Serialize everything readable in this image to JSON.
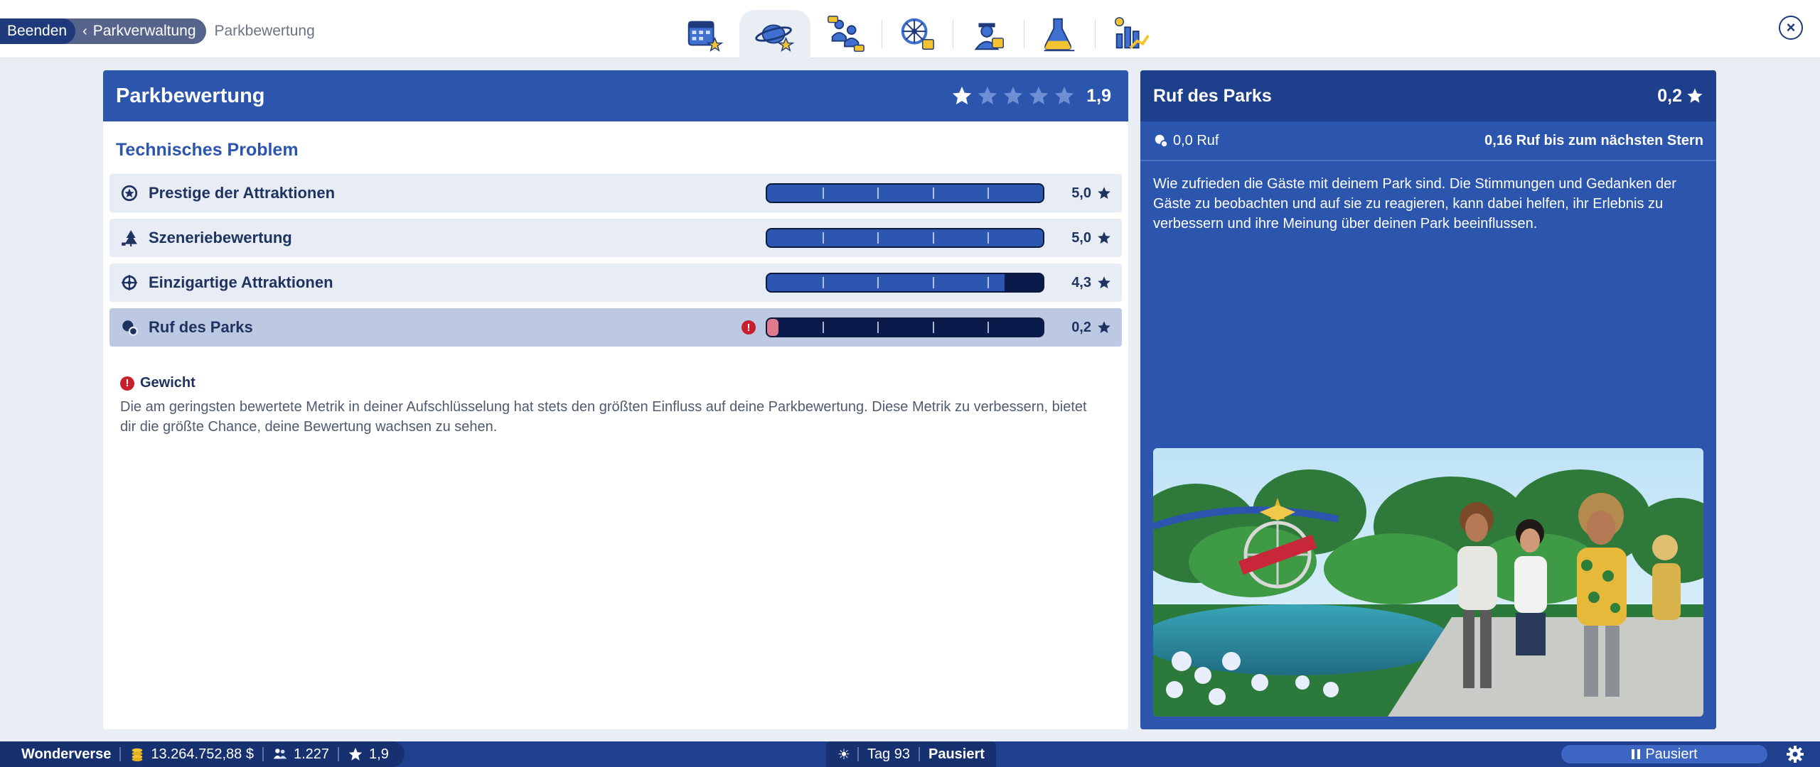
{
  "breadcrumb": {
    "exit_label": "Beenden",
    "parent_label": "Parkverwaltung",
    "current_label": "Parkbewertung"
  },
  "tabs": [
    {
      "name": "calendar",
      "icon": "calendar-star-icon",
      "active": false
    },
    {
      "name": "park-rating",
      "icon": "planet-star-icon",
      "active": true
    },
    {
      "name": "guests",
      "icon": "guests-icon",
      "active": false
    },
    {
      "name": "attractions",
      "icon": "ferris-wheel-icon",
      "active": false
    },
    {
      "name": "staff",
      "icon": "staff-icon",
      "active": false
    },
    {
      "name": "research",
      "icon": "research-flask-icon",
      "active": false
    },
    {
      "name": "finances",
      "icon": "finance-chart-icon",
      "active": false
    }
  ],
  "rating_panel": {
    "title": "Parkbewertung",
    "score": "1,9",
    "stars_value": 1.9,
    "section_title": "Technisches Problem",
    "metrics": [
      {
        "label": "Prestige der Attraktionen",
        "value": "5,0",
        "fraction": 1.0,
        "icon": "prestige-icon",
        "warning": false
      },
      {
        "label": "Szeneriebewertung",
        "value": "5,0",
        "fraction": 1.0,
        "icon": "scenery-tree-icon",
        "warning": false
      },
      {
        "label": "Einzigartige Attraktionen",
        "value": "4,3",
        "fraction": 0.86,
        "icon": "unique-attraction-icon",
        "warning": false
      },
      {
        "label": "Ruf des Parks",
        "value": "0,2",
        "fraction": 0.04,
        "icon": "reputation-icon",
        "warning": true
      }
    ],
    "weight": {
      "title": "Gewicht",
      "text": "Die am geringsten bewertete Metrik in deiner Aufschlüsselung hat stets den größten Einfluss auf deine Parkbewertung. Diese Metrik zu verbessern, bietet dir die größte Chance, deine Bewertung wachsen zu sehen."
    }
  },
  "detail_panel": {
    "title": "Ruf des Parks",
    "score": "0,2",
    "reputation": "0,0 Ruf",
    "next_star": "0,16 Ruf bis zum nächsten Stern",
    "description": "Wie zufrieden die Gäste mit deinem Park sind. Die Stimmungen und Gedanken der Gäste zu beobachten und auf sie zu reagieren, kann dabei helfen, ihr Erlebnis zu verbessern und ihre Meinung über deinen Park beeinflussen."
  },
  "status_bar": {
    "park_name": "Wonderverse",
    "money": "13.264.752,88 $",
    "guests": "1.227",
    "rating": "1,9",
    "day": "Tag 93",
    "state": "Pausiert",
    "speed_label": "Pausiert"
  },
  "colors": {
    "accent": "#2c55ad",
    "header_dark": "#1e3f8c",
    "warning": "#c7202c",
    "bar_fill": "#2d56b0"
  }
}
